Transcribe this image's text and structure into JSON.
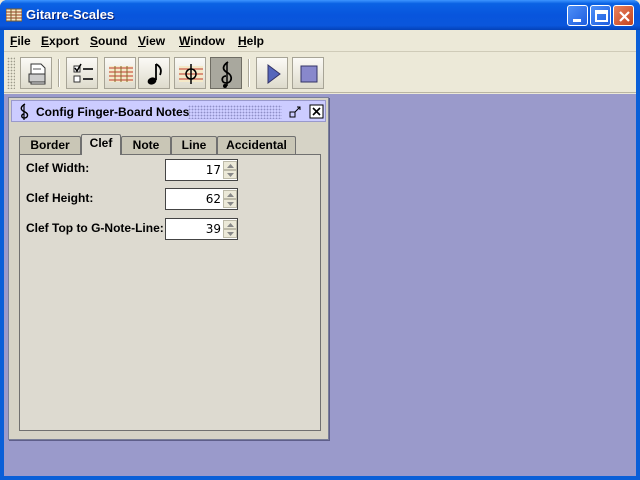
{
  "window": {
    "title": "Gitarre-Scales"
  },
  "menu": {
    "items": [
      "File",
      "Export",
      "Sound",
      "View",
      "Window",
      "Help"
    ]
  },
  "toolbar": {
    "icons": [
      "print-preview-icon",
      "checklist-icon",
      "fretboard-grid-icon",
      "note-icon",
      "fretboard-clef-icon",
      "clef-icon",
      "play-icon",
      "stop-icon"
    ]
  },
  "config_window": {
    "title": "Config Finger-Board Notes",
    "tabs": [
      "Border",
      "Clef",
      "Note",
      "Line",
      "Accidental"
    ],
    "selected_tab": "Clef",
    "fields": [
      {
        "label": "Clef Width:",
        "value": "17"
      },
      {
        "label": "Clef Height:",
        "value": "62"
      },
      {
        "label": "Clef Top to G-Note-Line:",
        "value": "39"
      }
    ]
  },
  "colors": {
    "desktop": "#9a9acb",
    "title_bar": "#0a56dc",
    "internal_title": "#ccccff"
  }
}
